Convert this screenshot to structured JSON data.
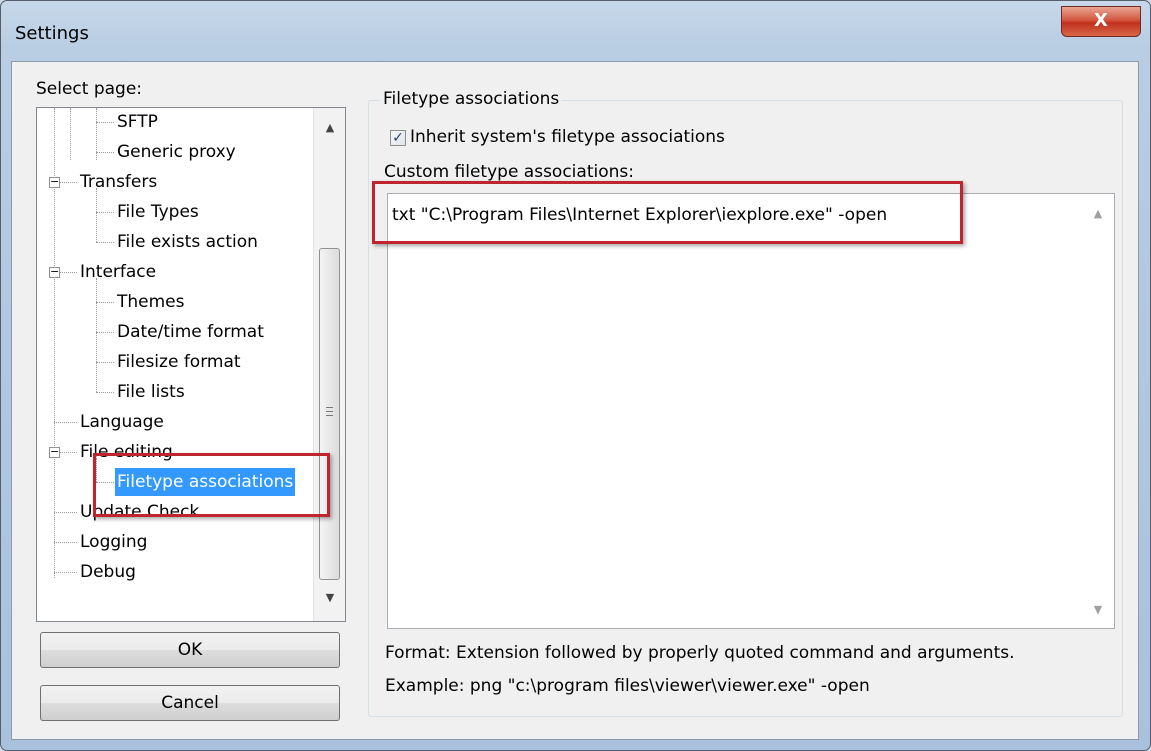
{
  "window": {
    "title": "Settings",
    "close_label": "X"
  },
  "sidebar": {
    "select_label": "Select page:",
    "tree": [
      {
        "label": "SFTP",
        "level": 3
      },
      {
        "label": "Generic proxy",
        "level": 3
      },
      {
        "label": "Transfers",
        "level": 1,
        "expanded": true
      },
      {
        "label": "File Types",
        "level": 2
      },
      {
        "label": "File exists action",
        "level": 2
      },
      {
        "label": "Interface",
        "level": 1,
        "expanded": true
      },
      {
        "label": "Themes",
        "level": 2
      },
      {
        "label": "Date/time format",
        "level": 2
      },
      {
        "label": "Filesize format",
        "level": 2
      },
      {
        "label": "File lists",
        "level": 2
      },
      {
        "label": "Language",
        "level": 1
      },
      {
        "label": "File editing",
        "level": 1,
        "expanded": true
      },
      {
        "label": "Filetype associations",
        "level": 2,
        "selected": true
      },
      {
        "label": "Update Check",
        "level": 1
      },
      {
        "label": "Logging",
        "level": 1
      },
      {
        "label": "Debug",
        "level": 1
      }
    ]
  },
  "buttons": {
    "ok": "OK",
    "cancel": "Cancel"
  },
  "main": {
    "group_title": "Filetype associations",
    "inherit_label": "Inherit system's filetype associations",
    "inherit_checked": true,
    "custom_label": "Custom filetype associations:",
    "custom_value": "txt \"C:\\Program Files\\Internet Explorer\\iexplore.exe\" -open",
    "format_text": "Format: Extension followed by properly quoted command and arguments.",
    "example_text": "Example: png \"c:\\program files\\viewer\\viewer.exe\" -open"
  },
  "colors": {
    "selection": "#3399ff",
    "highlight_box": "#c0242e",
    "dialog_bg": "#f0f0f0"
  },
  "icons": [
    "close-icon",
    "tree-expander-minus-icon",
    "scroll-up-arrow-icon",
    "scroll-down-arrow-icon",
    "checkbox-checked-icon"
  ]
}
